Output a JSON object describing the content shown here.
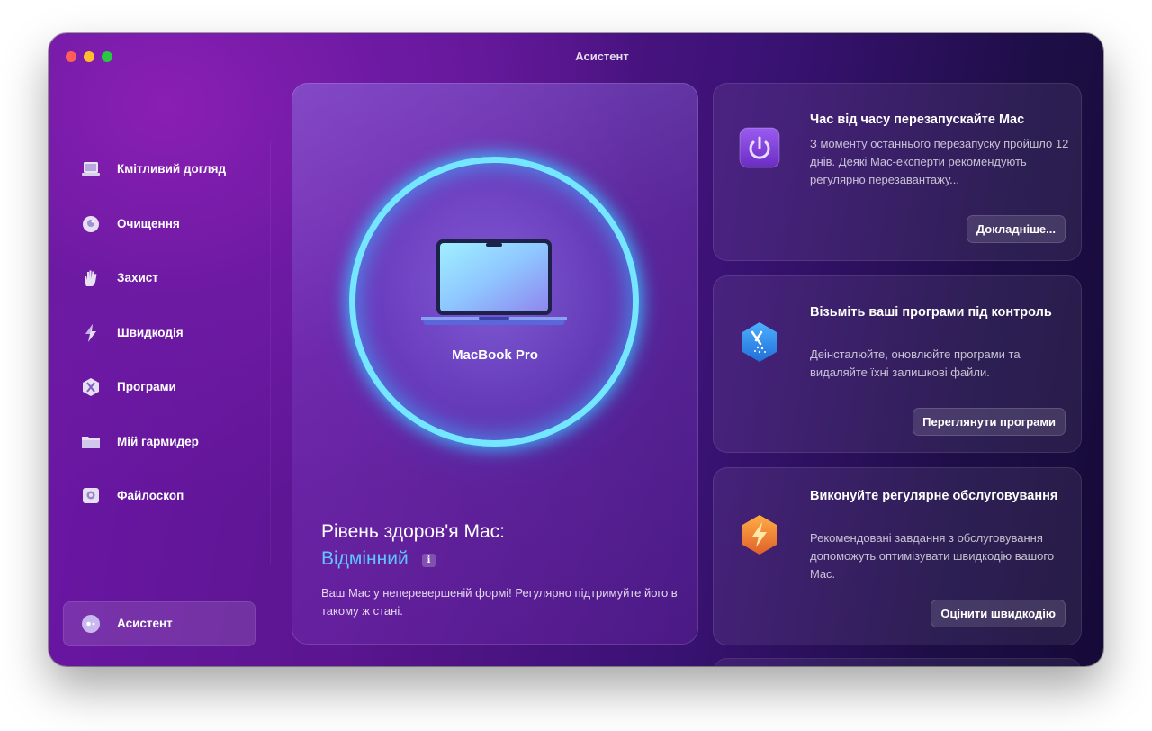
{
  "window": {
    "title": "Асистент"
  },
  "sidebar": {
    "items": [
      {
        "label": "Кмітливий догляд",
        "icon": "smart-care-icon"
      },
      {
        "label": "Очищення",
        "icon": "cleanup-icon"
      },
      {
        "label": "Захист",
        "icon": "protection-hand-icon"
      },
      {
        "label": "Швидкодія",
        "icon": "performance-icon"
      },
      {
        "label": "Програми",
        "icon": "applications-icon"
      },
      {
        "label": "Мій гармидер",
        "icon": "folder-clutter-icon"
      },
      {
        "label": "Файлоскоп",
        "icon": "space-lens-icon"
      }
    ],
    "assistant": {
      "label": "Асистент",
      "icon": "assistant-icon",
      "active": true
    }
  },
  "hero": {
    "device_name": "MacBook Pro",
    "health_title": "Рівень здоров'я Mac:",
    "health_status": "Відмінний",
    "info_glyph": "i",
    "description": "Ваш Mac у неперевершеній формі! Регулярно підтримуйте його в такому ж стані."
  },
  "cards": [
    {
      "title": "Час від часу перезапускайте Mac",
      "description": "З моменту останнього перезапуску пройшло 12 днів. Деякі Mac-експерти рекомендують регулярно перезавантажу...",
      "button": "Докладніше...",
      "icon": "power-icon"
    },
    {
      "title": "Візьміть ваші програми під контроль",
      "description": "Деінсталюйте, оновлюйте програми та видаляйте їхні залишкові файли.",
      "button": "Переглянути програми",
      "icon": "apps-hex-icon"
    },
    {
      "title": "Виконуйте регулярне обслуговування",
      "description": "Рекомендовані завдання з обслуговування допоможуть оптимізувати швидкодію вашого Mac.",
      "button": "Оцінити швидкодію",
      "icon": "lightning-icon"
    }
  ],
  "colors": {
    "accent_status": "#5fc6ff",
    "ring": "#74e6ff",
    "power_icon_bg": "#7b3fd6",
    "apps_icon_bg": "#2a8cf0",
    "lightning_icon_bg": "#f0822a"
  }
}
